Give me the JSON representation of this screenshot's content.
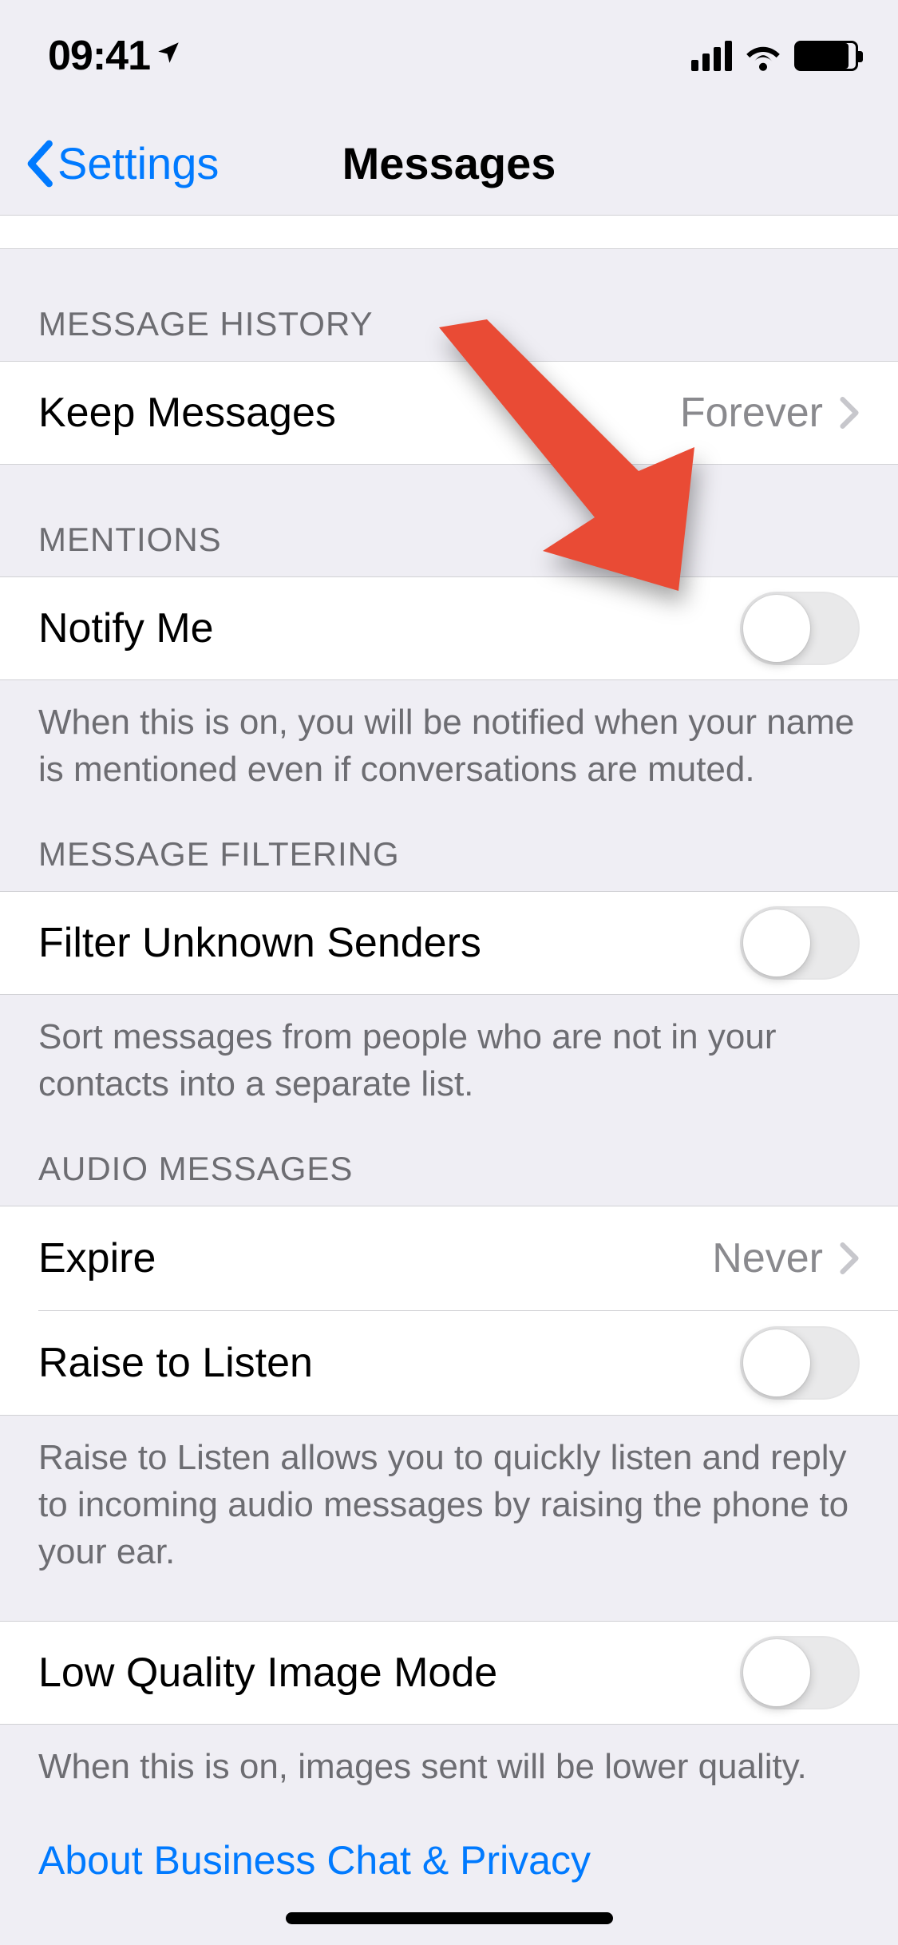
{
  "status": {
    "time": "09:41"
  },
  "nav": {
    "back": "Settings",
    "title": "Messages"
  },
  "sections": {
    "history": {
      "header": "MESSAGE HISTORY",
      "keepMessages": {
        "label": "Keep Messages",
        "value": "Forever"
      }
    },
    "mentions": {
      "header": "MENTIONS",
      "notifyMe": {
        "label": "Notify Me",
        "on": false
      },
      "footer": "When this is on, you will be notified when your name is mentioned even if conversations are muted."
    },
    "filtering": {
      "header": "MESSAGE FILTERING",
      "filterUnknown": {
        "label": "Filter Unknown Senders",
        "on": false
      },
      "footer": "Sort messages from people who are not in your contacts into a separate list."
    },
    "audio": {
      "header": "AUDIO MESSAGES",
      "expire": {
        "label": "Expire",
        "value": "Never"
      },
      "raise": {
        "label": "Raise to Listen",
        "on": false
      },
      "footer": "Raise to Listen allows you to quickly listen and reply to incoming audio messages by raising the phone to your ear."
    },
    "image": {
      "lowQuality": {
        "label": "Low Quality Image Mode",
        "on": false
      },
      "footer": "When this is on, images sent will be lower quality."
    }
  },
  "link": "About Business Chat & Privacy"
}
